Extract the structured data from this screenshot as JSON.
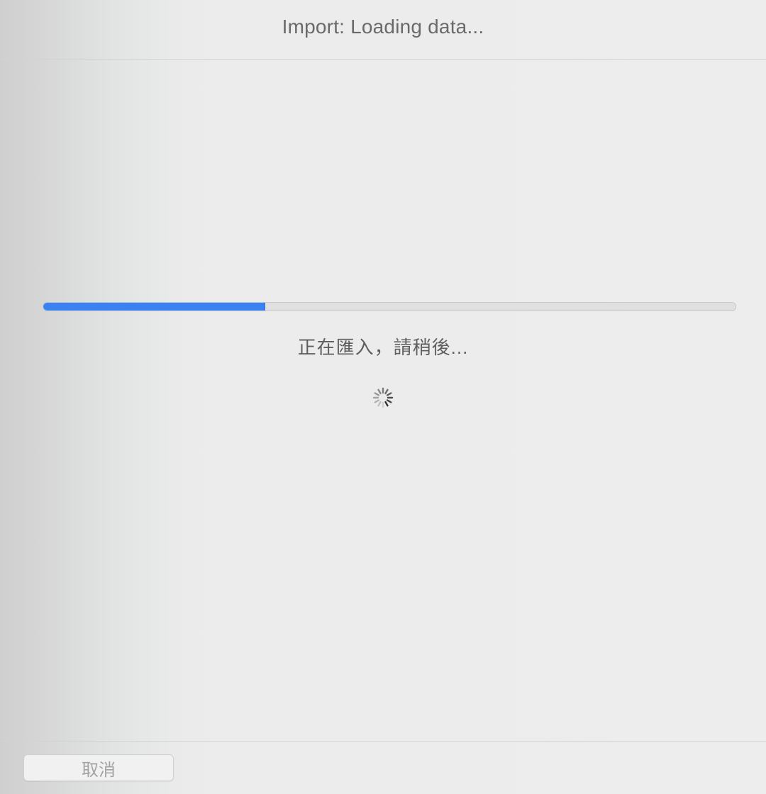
{
  "window": {
    "title": "Import: Loading data..."
  },
  "progress": {
    "fraction": 0.32,
    "fill_color": "#3a82f2"
  },
  "status": {
    "message": "正在匯入，請稍後..."
  },
  "spinner": {
    "icon": "spinner-icon"
  },
  "footer": {
    "cancel_label": "取消",
    "cancel_enabled": false
  }
}
